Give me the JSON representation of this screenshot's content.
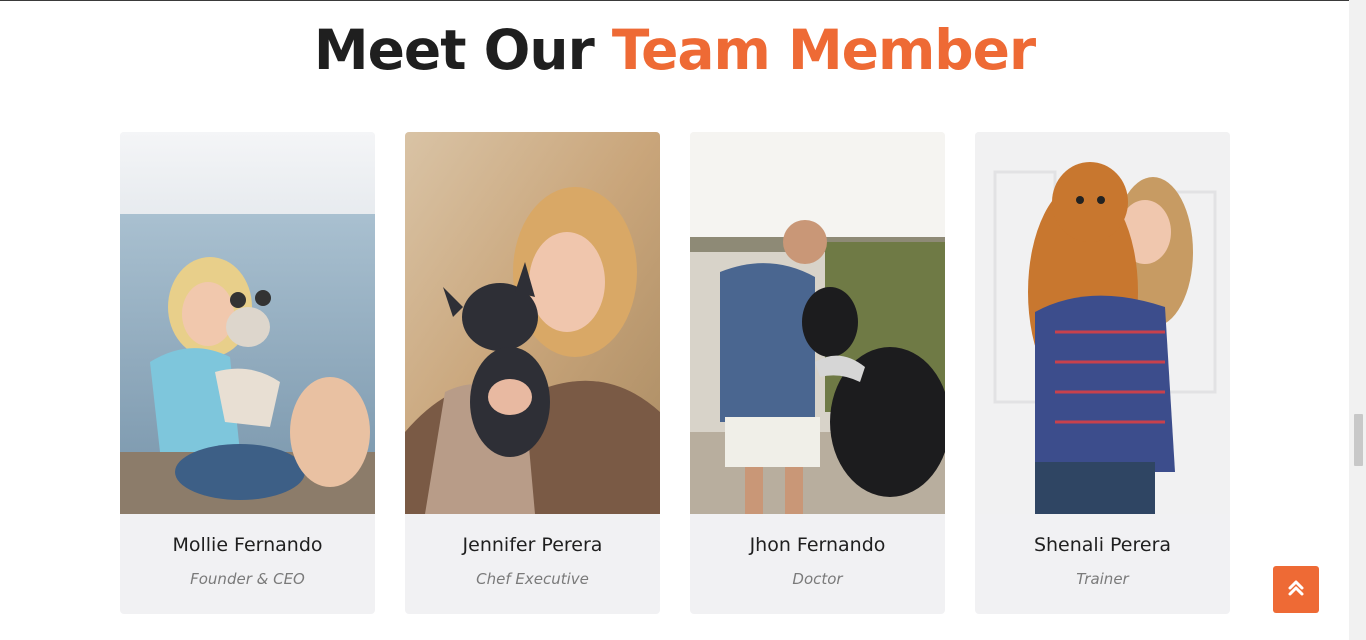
{
  "section": {
    "title_part1": "Meet Our",
    "title_part2": "Team Member",
    "accent_color": "#ee6a35"
  },
  "team": [
    {
      "name": "Mollie Fernando",
      "role": "Founder & CEO",
      "photo": "woman-with-french-bulldog-by-sea"
    },
    {
      "name": "Jennifer Perera",
      "role": "Chef Executive",
      "photo": "woman-holding-black-french-bulldog"
    },
    {
      "name": "Jhon Fernando",
      "role": "Doctor",
      "photo": "man-with-black-dog-at-lake"
    },
    {
      "name": "Shenali Perera",
      "role": "Trainer",
      "photo": "woman-holding-pomeranian"
    }
  ],
  "back_to_top": {
    "icon": "double-chevron-up-icon"
  }
}
